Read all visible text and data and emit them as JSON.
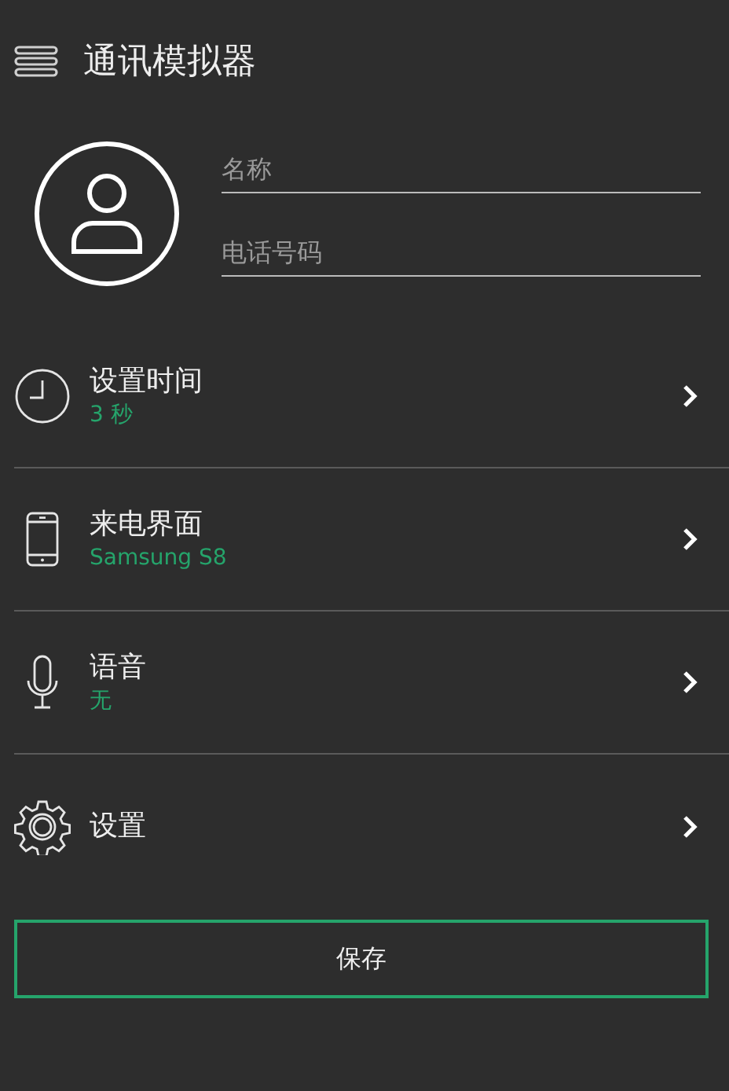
{
  "header": {
    "title": "通讯模拟器"
  },
  "contact": {
    "name_field": {
      "placeholder": "名称"
    },
    "phone_field": {
      "placeholder": "电话号码"
    }
  },
  "menu_items": [
    {
      "kind": "clock",
      "label": "设置时间",
      "value": "3 秒"
    },
    {
      "kind": "phone",
      "label": "来电界面",
      "value": "Samsung S8"
    },
    {
      "kind": "mic",
      "label": "语音",
      "value": "无"
    },
    {
      "kind": "gear",
      "label": "设置"
    }
  ],
  "save_button": {
    "label": "保存"
  }
}
